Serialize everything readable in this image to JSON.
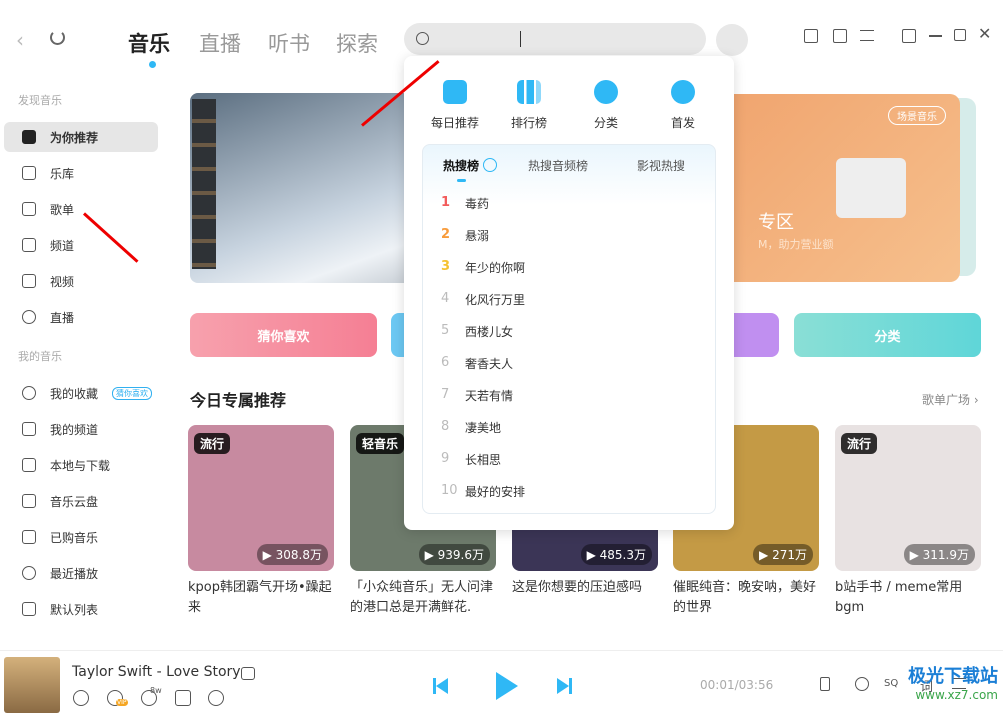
{
  "nav": {
    "tabs": [
      "音乐",
      "直播",
      "听书",
      "探索"
    ],
    "active": 0,
    "search_placeholder": ""
  },
  "sidebar": {
    "discover_title": "发现音乐",
    "discover": [
      {
        "label": "为你推荐",
        "icon": "star-icon"
      },
      {
        "label": "乐库",
        "icon": "music-library-icon"
      },
      {
        "label": "歌单",
        "icon": "playlist-icon"
      },
      {
        "label": "频道",
        "icon": "radio-icon"
      },
      {
        "label": "视频",
        "icon": "video-icon"
      },
      {
        "label": "直播",
        "icon": "live-icon"
      }
    ],
    "mine_title": "我的音乐",
    "mine": [
      {
        "label": "我的收藏",
        "icon": "heart-icon",
        "badge": "猜你喜欢"
      },
      {
        "label": "我的频道",
        "icon": "radio-icon"
      },
      {
        "label": "本地与下载",
        "icon": "download-icon"
      },
      {
        "label": "音乐云盘",
        "icon": "cloud-icon"
      },
      {
        "label": "已购音乐",
        "icon": "bag-icon"
      },
      {
        "label": "最近播放",
        "icon": "clock-icon"
      },
      {
        "label": "默认列表",
        "icon": "list-icon"
      }
    ]
  },
  "banner": {
    "badge": "场景音乐",
    "title": "专区",
    "subtitle": "M，助力营业额"
  },
  "quick": [
    {
      "label": "猜你喜欢",
      "color": "#f7889a"
    },
    {
      "label": "分类",
      "color": "#5fd6d2"
    }
  ],
  "section": {
    "title": "今日专属推荐",
    "more": "歌单广场 ›"
  },
  "cards": [
    {
      "tag": "流行",
      "plays": "308.8万",
      "title": "kpop韩团霸气开场•躁起来",
      "bg": "#c78aa0"
    },
    {
      "tag": "轻音乐",
      "plays": "939.6万",
      "title": "「小众纯音乐」无人问津的港口总是开满鲜花.",
      "bg": "#6d7a6b"
    },
    {
      "tag": "",
      "plays": "485.3万",
      "title": "这是你想要的压迫感吗",
      "bg": "#3b3556"
    },
    {
      "tag": "",
      "plays": "271万",
      "title": "催眠纯音：晚安呐，美好的世界",
      "bg": "#c49a45"
    },
    {
      "tag": "流行",
      "plays": "311.9万",
      "title": "b站手书 / meme常用bgm",
      "bg": "#e8e2e2"
    }
  ],
  "popup": {
    "quick": [
      {
        "label": "每日推荐",
        "icon": "calendar-icon"
      },
      {
        "label": "排行榜",
        "icon": "chart-icon"
      },
      {
        "label": "分类",
        "icon": "grid-icon"
      },
      {
        "label": "首发",
        "icon": "disc-icon"
      }
    ],
    "tabs": [
      "热搜榜",
      "热搜音频榜",
      "影视热搜"
    ],
    "hot": [
      {
        "n": "1",
        "t": "毒药",
        "c": "#f25b5b"
      },
      {
        "n": "2",
        "t": "悬溺",
        "c": "#f89c3c"
      },
      {
        "n": "3",
        "t": "年少的你啊",
        "c": "#f5c232"
      },
      {
        "n": "4",
        "t": "化风行万里"
      },
      {
        "n": "5",
        "t": "西楼儿女"
      },
      {
        "n": "6",
        "t": "奢香夫人"
      },
      {
        "n": "7",
        "t": "天若有情"
      },
      {
        "n": "8",
        "t": "凄美地"
      },
      {
        "n": "9",
        "t": "长相思"
      },
      {
        "n": "10",
        "t": "最好的安排"
      }
    ]
  },
  "player": {
    "song": "Taylor Swift - Love Story",
    "time": "00:01/03:56",
    "comment_count": "8w",
    "vip": "VIP",
    "quality": "SQ",
    "volume_label": "词",
    "accent": "#2fb8f5"
  },
  "watermark": {
    "text": "极光下载站",
    "url": "www.xz7.com"
  }
}
